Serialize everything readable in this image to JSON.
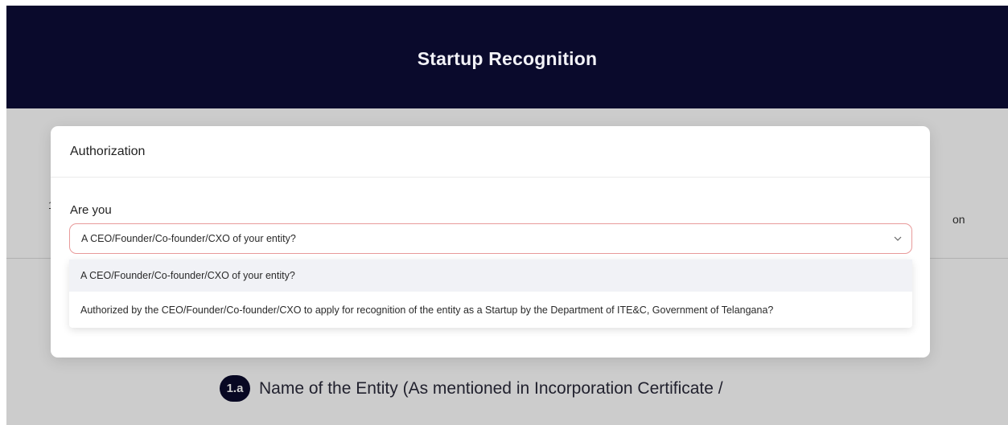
{
  "header": {
    "title": "Startup Recognition"
  },
  "page": {
    "step_number": "1",
    "step_tail_text": "on",
    "question": {
      "badge": "1.a",
      "text": "Name of the Entity (As mentioned in Incorporation Certificate /"
    }
  },
  "modal": {
    "title": "Authorization",
    "field_label": "Are you",
    "select": {
      "value": "A CEO/Founder/Co-founder/CXO of your entity?",
      "options": [
        "A CEO/Founder/Co-founder/CXO of your entity?",
        "Authorized by the CEO/Founder/Co-founder/CXO to apply for recognition of the entity as a Startup by the Department of ITE&C, Government of Telangana?"
      ]
    }
  },
  "icons": {
    "select_chevron": "chevron-down-icon"
  },
  "colors": {
    "brand_dark": "#0a0a2c",
    "select_border": "#e89a9a",
    "option_highlight": "#f1f2f6"
  }
}
